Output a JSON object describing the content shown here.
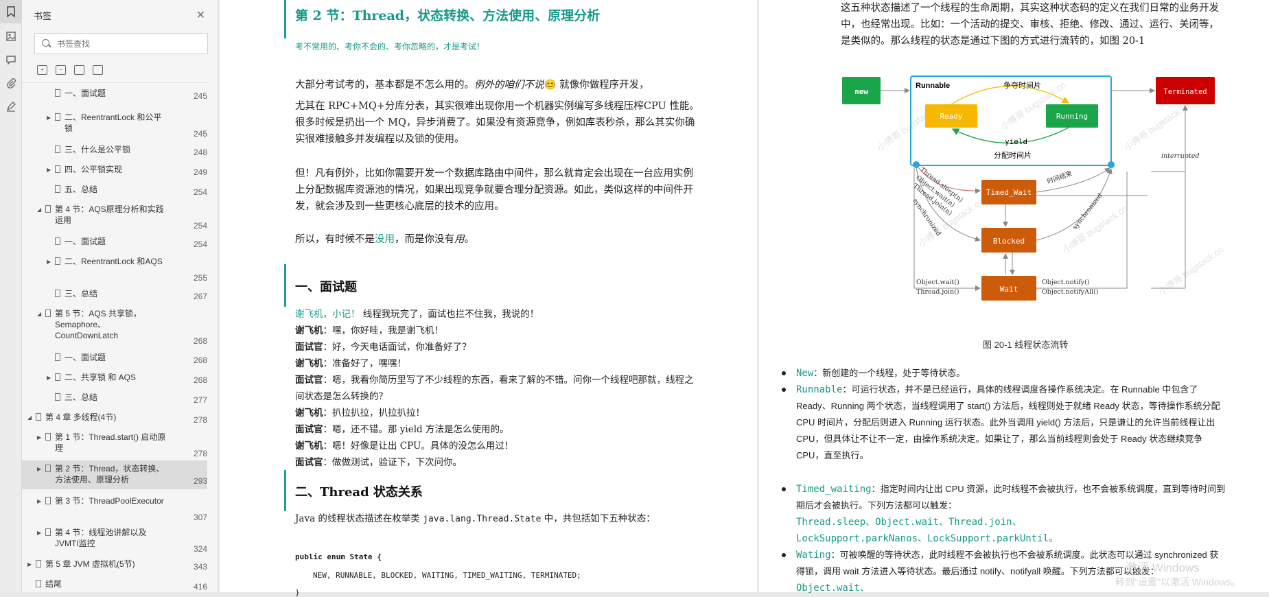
{
  "sidebar": {
    "title": "书签",
    "search_placeholder": "书签查找",
    "items": [
      {
        "label": "一、面试题",
        "page": "245"
      },
      {
        "label": "二、ReentrantLock 和公平锁",
        "page": "245"
      },
      {
        "label": "三、什么是公平锁",
        "page": "248"
      },
      {
        "label": "四、公平锁实现",
        "page": "249"
      },
      {
        "label": "五、总结",
        "page": "254"
      },
      {
        "label": "第 4 节：AQS原理分析和实践运用",
        "page": "254"
      },
      {
        "label": "一、面试题",
        "page": "254"
      },
      {
        "label": "二、ReentrantLock 和AQS",
        "page": "255"
      },
      {
        "label": "三、总结",
        "page": "267"
      },
      {
        "label": "第 5 节：AQS 共享锁，Semaphore、CountDownLatch",
        "page": "268"
      },
      {
        "label": "一、面试题",
        "page": "268"
      },
      {
        "label": "二、共享锁 和 AQS",
        "page": "268"
      },
      {
        "label": "三、总结",
        "page": "277"
      },
      {
        "label": "第 4 章 多线程(4节)",
        "page": "278"
      },
      {
        "label": "第 1 节：Thread.start() 启动原理",
        "page": "278"
      },
      {
        "label": "第 2 节：Thread，状态转换、方法使用、原理分析",
        "page": "293"
      },
      {
        "label": "第 3 节：ThreadPoolExecutor",
        "page": "307"
      },
      {
        "label": "第 4 节：线程池讲解以及JVMTI监控",
        "page": "324"
      },
      {
        "label": "第 5 章 JVM 虚拟机(5节)",
        "page": "343"
      },
      {
        "label": "结尾",
        "page": "416"
      }
    ]
  },
  "page1": {
    "title": "第 2 节：Thread，状态转换、方法使用、原理分析",
    "subtitle": "考不常用的、考你不会的、考你忽略的，才是考试！",
    "para1_a": "大部分考试考的，基本都是不怎么用的。",
    "para1_b": "例外的咱们不说",
    "para1_c": "😊 就像你做程序开发，",
    "para1_d": "尤其在 RPC+MQ+分库分表，其实很难出现你用一个机器实例编写多线程压榨CPU 性能。很多时候是扔出一个 MQ，异步消费了。如果没有资源竞争，例如库表秒杀，那么其实你确实很难接触多并发编程以及锁的使用。",
    "para2": "但！凡有例外，比如你需要开发一个数据库路由中间件，那么就肯定会出现在一台应用实例上分配数据库资源池的情况，如果出现竞争就要合理分配资源。如此，类似这样的中间件开发，就会涉及到一些更核心底层的技术的应用。",
    "para3_a": "所以，有时候不是",
    "para3_b": "没用",
    "para3_c": "，而是你没有",
    "para3_d": "用",
    "para3_e": "。",
    "sec1": "一、面试题",
    "dialog_intro_a": "谢飞机，小记！",
    "dialog_intro_b": " 线程我玩完了，面试也拦不住我，我说的！",
    "dialog": [
      {
        "who": "谢飞机",
        "text": "：嘿，你好哇，我是谢飞机！"
      },
      {
        "who": "面试官",
        "text": "：好，今天电话面试，你准备好了？"
      },
      {
        "who": "谢飞机",
        "text": "：准备好了，嘿嘿！"
      },
      {
        "who": "面试官",
        "text": "：嗯，我看你简历里写了不少线程的东西，看来了解的不错。问你一个线程吧那就，线程之间状态是怎么转换的？"
      },
      {
        "who": "谢飞机",
        "text": "：扒拉扒拉，扒拉扒拉！"
      },
      {
        "who": "面试官",
        "text": "：嗯，还不错。那 yield 方法是怎么使用的。"
      },
      {
        "who": "谢飞机",
        "text": "：嗯！好像是让出 CPU。具体的没怎么用过！"
      },
      {
        "who": "面试官",
        "text": "：做做测试，验证下，下次问你。"
      }
    ],
    "sec2": "二、Thread 状态关系",
    "para4_a": "Java 的线程状态描述在枚举类 ",
    "para4_code": "java.lang.Thread.State",
    "para4_b": " 中，共包括如下五种状态：",
    "code1": "public enum State {",
    "code2": "NEW, RUNNABLE, BLOCKED, WAITING, TIMED_WAITING, TERMINATED;",
    "code3": "}"
  },
  "page2": {
    "intro": "这五种状态描述了一个线程的生命周期，其实这种状态码的定义在我们日常的业务开发中，也经常出现。比如：一个活动的提交、审核、拒绝、修改、通过、运行、关闭等，是类似的。那么线程的状态是通过下图的方式进行流转的，如图 20-1",
    "caption": "图 20-1 线程状态流转",
    "diagram": {
      "new": "new",
      "runnable": "Runnable",
      "ready": "Ready",
      "running": "Running",
      "terminated": "Terminated",
      "timed_wait": "Timed_Wait",
      "blocked": "Blocked",
      "wait": "Wait",
      "contend": "争夺时间片",
      "yield": "yield",
      "alloc": "分配时间片",
      "time_up": "时间结束",
      "sync1": "synchronized",
      "sync2": "synchronized",
      "interrupted": "interrupted",
      "sleep": "Thread.sleep(n)",
      "wait_n": "Object.wait(n)",
      "join_n": "Thread.join(n)",
      "obj_wait": "Object.wait()",
      "thr_join": "Thread.join()",
      "notify": "Object.notify()",
      "notify_all": "Object.notifyAll()",
      "watermark": "小傅哥 bugstack.cn",
      "colors": {
        "new": "#1aa54a",
        "running": "#1aa54a",
        "ready": "#f6b800",
        "terminated": "#cc0000",
        "orange": "#cc5c0a",
        "runnable_border": "#22a8e0"
      }
    },
    "bullets": [
      {
        "term": "New",
        "text": "：新创建的一个线程，处于等待状态。"
      },
      {
        "term": "Runnable",
        "text": "：可运行状态，并不是已经运行，具体的线程调度各操作系统决定。在 Runnable 中包含了 Ready、Running 两个状态，当线程调用了 start() 方法后，线程则处于就绪 Ready 状态，等待操作系统分配 CPU 时间片，分配后则进入 Running 运行状态。此外当调用 yield() 方法后，只是谦让的允许当前线程让出 CPU，但具体让不让不一定，由操作系统决定。如果让了，那么当前线程则会处于 Ready 状态继续竞争 CPU，直至执行。"
      },
      {
        "term": "Timed_waiting",
        "text": "：指定时间内让出 CPU 资源，此时线程不会被执行，也不会被系统调度，直到等待时间到期后才会被执行。下列方法都可以触发："
      },
      {
        "term": "Wating",
        "text": "：可被唤醒的等待状态，此时线程不会被执行也不会被系统调度。此状态可以通过 synchronized 获得锁，调用 wait 方法进入等待状态。最后通过 notify、notifyall 唤醒。下列方法都可以触发："
      }
    ],
    "timed_methods_1": "Thread.sleep、Object.wait、Thread.join、",
    "timed_methods_2": "LockSupport.parkNanos、LockSupport.parkUntil。",
    "wait_method": "Object.wait、",
    "activate_1": "激活 Windows",
    "activate_2": "转到\"设置\"以激活 Windows。"
  }
}
